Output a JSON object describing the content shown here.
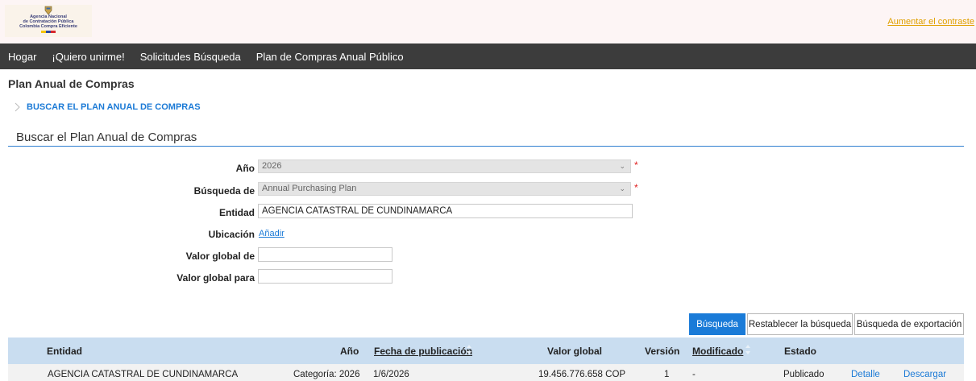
{
  "header": {
    "logo": {
      "line1": "Agencia Nacional",
      "line2": "de Contratación Pública",
      "line3": "Colombia Compra Eficiente"
    },
    "contrast_link": "Aumentar el contraste"
  },
  "nav": {
    "items": [
      {
        "label": "Hogar"
      },
      {
        "label": "¡Quiero unirme!"
      },
      {
        "label": "Solicitudes Búsqueda"
      },
      {
        "label": "Plan de Compras Anual Público"
      }
    ]
  },
  "page": {
    "title": "Plan Anual de Compras",
    "breadcrumb": "BUSCAR EL PLAN ANUAL DE COMPRAS",
    "section_title": "Buscar el Plan Anual de Compras"
  },
  "form": {
    "year": {
      "label": "Año",
      "value": "2026",
      "required": "*"
    },
    "search_by": {
      "label": "Búsqueda de",
      "value": "Annual Purchasing Plan",
      "required": "*"
    },
    "entity": {
      "label": "Entidad",
      "value": "AGENCIA CATASTRAL DE CUNDINAMARCA"
    },
    "location": {
      "label": "Ubicación",
      "link": "Añadir"
    },
    "value_from": {
      "label": "Valor global de",
      "value": ""
    },
    "value_to": {
      "label": "Valor global para",
      "value": ""
    }
  },
  "buttons": {
    "search": "Búsqueda",
    "reset": "Restablecer la búsqueda",
    "export": "Búsqueda de exportación"
  },
  "table": {
    "columns": {
      "entity": "Entidad",
      "year": "Año",
      "published": "Fecha de publicación",
      "global_value": "Valor global",
      "version": "Versión",
      "modified": "Modificado",
      "status": "Estado"
    },
    "rows": [
      {
        "entity": "AGENCIA CATASTRAL DE CUNDINAMARCA",
        "year": "Categoría: 2026",
        "published": "1/6/2026",
        "global_value": "19.456.776.658 COP",
        "version": "1",
        "modified": "-",
        "status": "Publicado",
        "detail": "Detalle",
        "download": "Descargar"
      }
    ]
  },
  "colors": {
    "accent": "#1a7bd8",
    "navbar": "#3c3c3c",
    "table_header": "#c9ddf0",
    "contrast_link": "#e0a000"
  }
}
